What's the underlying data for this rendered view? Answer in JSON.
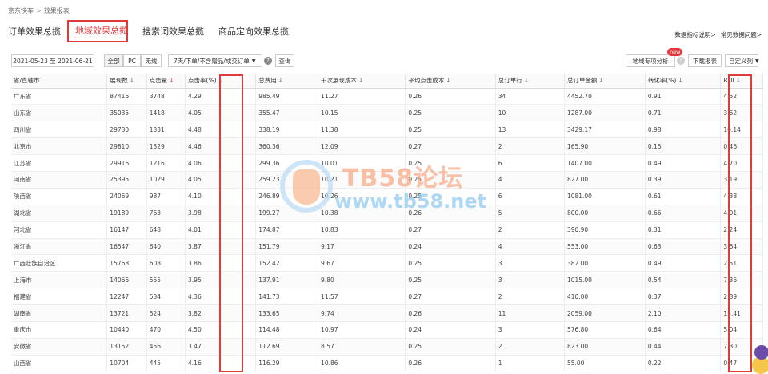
{
  "breadcrumb": {
    "items": [
      "京东快车",
      "效果报表"
    ]
  },
  "tabs": [
    "订单效果总揽",
    "地域效果总揽",
    "搜索词效果总揽",
    "商品定向效果总揽"
  ],
  "top_links": [
    "数据指标说明>",
    "常见数据问题>"
  ],
  "toolbar": {
    "date_range": "2021-05-23 至 2021-06-21",
    "device_all": "全部",
    "device_pc": "PC",
    "device_wireless": "无线",
    "attribution": "7天/下单/不含赠品/成交订单",
    "query": "查询",
    "region_analysis": "地域专项分析",
    "new_badge": "new",
    "download": "下载报表",
    "custom_cols": "自定义列"
  },
  "table": {
    "headers": [
      "省/直辖市",
      "展现数",
      "点击量",
      "点击率(%)",
      "总费用",
      "千次展现成本",
      "平均点击成本",
      "总订单行",
      "总订单金额",
      "转化率(%)",
      "ROI"
    ],
    "rows": [
      [
        "广东省",
        "87416",
        "3748",
        "4.29",
        "985.49",
        "11.27",
        "0.26",
        "34",
        "4452.70",
        "0.91",
        "4.52"
      ],
      [
        "山东省",
        "35035",
        "1418",
        "4.05",
        "355.47",
        "10.15",
        "0.25",
        "10",
        "1287.00",
        "0.71",
        "3.62"
      ],
      [
        "四川省",
        "29730",
        "1331",
        "4.48",
        "338.19",
        "11.38",
        "0.25",
        "13",
        "3429.17",
        "0.98",
        "10.14"
      ],
      [
        "北京市",
        "29810",
        "1329",
        "4.46",
        "360.36",
        "12.09",
        "0.27",
        "2",
        "165.90",
        "0.15",
        "0.46"
      ],
      [
        "江苏省",
        "29916",
        "1216",
        "4.06",
        "299.36",
        "10.01",
        "0.25",
        "6",
        "1407.00",
        "0.49",
        "4.70"
      ],
      [
        "河南省",
        "25395",
        "1029",
        "4.05",
        "259.23",
        "10.21",
        "0.25",
        "4",
        "827.00",
        "0.39",
        "3.19"
      ],
      [
        "陕西省",
        "24069",
        "987",
        "4.10",
        "246.89",
        "10.26",
        "0.25",
        "6",
        "1081.00",
        "0.61",
        "4.38"
      ],
      [
        "湖北省",
        "19189",
        "763",
        "3.98",
        "199.27",
        "10.38",
        "0.26",
        "5",
        "800.00",
        "0.66",
        "4.01"
      ],
      [
        "河北省",
        "16147",
        "648",
        "4.01",
        "174.87",
        "10.83",
        "0.27",
        "2",
        "390.90",
        "0.31",
        "2.24"
      ],
      [
        "浙江省",
        "16547",
        "640",
        "3.87",
        "151.79",
        "9.17",
        "0.24",
        "4",
        "553.00",
        "0.63",
        "3.64"
      ],
      [
        "广西壮族自治区",
        "15768",
        "608",
        "3.86",
        "152.42",
        "9.67",
        "0.25",
        "3",
        "382.00",
        "0.49",
        "2.51"
      ],
      [
        "上海市",
        "14066",
        "555",
        "3.95",
        "137.91",
        "9.80",
        "0.25",
        "3",
        "1015.00",
        "0.54",
        "7.36"
      ],
      [
        "福建省",
        "12247",
        "534",
        "4.36",
        "141.73",
        "11.57",
        "0.27",
        "2",
        "410.00",
        "0.37",
        "2.89"
      ],
      [
        "湖南省",
        "13721",
        "524",
        "3.82",
        "133.65",
        "9.74",
        "0.26",
        "11",
        "2059.00",
        "2.10",
        "15.41"
      ],
      [
        "重庆市",
        "10440",
        "470",
        "4.50",
        "114.48",
        "10.97",
        "0.24",
        "3",
        "576.80",
        "0.64",
        "5.04"
      ],
      [
        "安徽省",
        "13152",
        "456",
        "3.47",
        "112.69",
        "8.57",
        "0.25",
        "2",
        "823.00",
        "0.44",
        "7.30"
      ],
      [
        "山西省",
        "10704",
        "445",
        "4.16",
        "116.29",
        "10.86",
        "0.26",
        "1",
        "55.00",
        "0.22",
        "0.47"
      ]
    ]
  },
  "watermark": {
    "title": "TB58论坛",
    "url": "www.tb58.net"
  },
  "colors": {
    "accent": "#e4393c",
    "highlight_box": "#e03a3a"
  },
  "icons": [
    "help-icon",
    "sort-down-icon",
    "chevron-down-icon"
  ]
}
